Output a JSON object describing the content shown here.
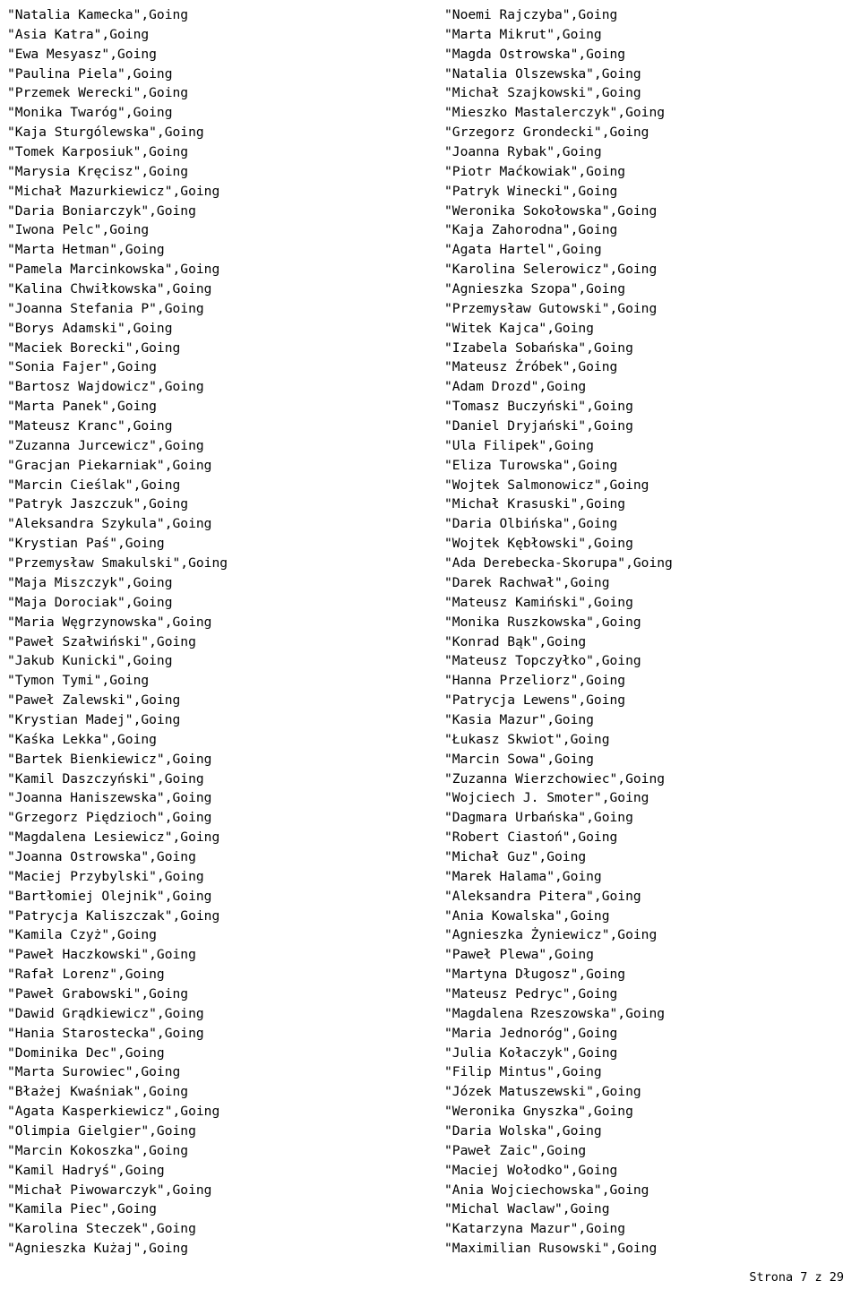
{
  "document": {
    "footer_text": "Strona 7 z 29",
    "status_label": "Going",
    "line_suffix": "\",Going",
    "line_prefix": "\""
  },
  "columns": {
    "left": [
      "\"Natalia Kamecka\",Going",
      "\"Asia Katra\",Going",
      "\"Ewa Mesyasz\",Going",
      "\"Paulina Piela\",Going",
      "\"Przemek Werecki\",Going",
      "\"Monika Twaróg\",Going",
      "\"Kaja Sturgólewska\",Going",
      "\"Tomek Karposiuk\",Going",
      "\"Marysia Kręcisz\",Going",
      "\"Michał Mazurkiewicz\",Going",
      "\"Daria Boniarczyk\",Going",
      "\"Iwona Pelc\",Going",
      "\"Marta Hetman\",Going",
      "\"Pamela Marcinkowska\",Going",
      "\"Kalina Chwiłkowska\",Going",
      "\"Joanna Stefania P\",Going",
      "\"Borys Adamski\",Going",
      "\"Maciek Borecki\",Going",
      "\"Sonia Fajer\",Going",
      "\"Bartosz Wajdowicz\",Going",
      "\"Marta Panek\",Going",
      "\"Mateusz Kranc\",Going",
      "\"Zuzanna Jurcewicz\",Going",
      "\"Gracjan Piekarniak\",Going",
      "\"Marcin Cieślak\",Going",
      "\"Patryk Jaszczuk\",Going",
      "\"Aleksandra Szykula\",Going",
      "\"Krystian Paś\",Going",
      "\"Przemysław Smakulski\",Going",
      "\"Maja Miszczyk\",Going",
      "\"Maja Dorociak\",Going",
      "\"Maria Węgrzynowska\",Going",
      "\"Paweł Szałwiński\",Going",
      "\"Jakub Kunicki\",Going",
      "\"Tymon Tymi\",Going",
      "\"Paweł Zalewski\",Going",
      "\"Krystian Madej\",Going",
      "\"Kaśka Lekka\",Going",
      "\"Bartek Bienkiewicz\",Going",
      "\"Kamil Daszczyński\",Going",
      "\"Joanna Haniszewska\",Going",
      "\"Grzegorz Piędzioch\",Going",
      "\"Magdalena Lesiewicz\",Going",
      "\"Joanna Ostrowska\",Going",
      "\"Maciej Przybylski\",Going",
      "\"Bartłomiej Olejnik\",Going",
      "\"Patrycja Kaliszczak\",Going",
      "\"Kamila Czyż\",Going",
      "\"Paweł Haczkowski\",Going",
      "\"Rafał Lorenz\",Going",
      "\"Paweł Grabowski\",Going",
      "\"Dawid Grądkiewicz\",Going",
      "\"Hania Starostecka\",Going",
      "\"Dominika Dec\",Going",
      "\"Marta Surowiec\",Going",
      "\"Błażej Kwaśniak\",Going",
      "\"Agata Kasperkiewicz\",Going",
      "\"Olimpia Gielgier\",Going",
      "\"Marcin Kokoszka\",Going",
      "\"Kamil Hadryś\",Going",
      "\"Michał Piwowarczyk\",Going",
      "\"Kamila Piec\",Going",
      "\"Karolina Steczek\",Going",
      "\"Agnieszka Kużaj\",Going"
    ],
    "right": [
      "\"Noemi Rajczyba\",Going",
      "\"Marta Mikrut\",Going",
      "\"Magda Ostrowska\",Going",
      "\"Natalia Olszewska\",Going",
      "\"Michał Szajkowski\",Going",
      "\"Mieszko Mastalerczyk\",Going",
      "\"Grzegorz Grondecki\",Going",
      "\"Joanna Rybak\",Going",
      "\"Piotr Maćkowiak\",Going",
      "\"Patryk Winecki\",Going",
      "\"Weronika Sokołowska\",Going",
      "\"Kaja Zahorodna\",Going",
      "\"Agata Hartel\",Going",
      "\"Karolina Selerowicz\",Going",
      "\"Agnieszka Szopa\",Going",
      "\"Przemysław Gutowski\",Going",
      "\"Witek Kajca\",Going",
      "\"Izabela Sobańska\",Going",
      "\"Mateusz Źróbek\",Going",
      "\"Adam Drozd\",Going",
      "\"Tomasz Buczyński\",Going",
      "\"Daniel Dryjański\",Going",
      "\"Ula Filipek\",Going",
      "\"Eliza Turowska\",Going",
      "\"Wojtek Salmonowicz\",Going",
      "\"Michał Krasuski\",Going",
      "\"Daria Olbińska\",Going",
      "\"Wojtek Kębłowski\",Going",
      "\"Ada Derebecka-Skorupa\",Going",
      "\"Darek Rachwał\",Going",
      "\"Mateusz Kamiński\",Going",
      "\"Monika Ruszkowska\",Going",
      "\"Konrad Bąk\",Going",
      "\"Mateusz Topczyłko\",Going",
      "\"Hanna Przeliorz\",Going",
      "\"Patrycja Lewens\",Going",
      "\"Kasia Mazur\",Going",
      "\"Łukasz Skwiot\",Going",
      "\"Marcin Sowa\",Going",
      "\"Zuzanna Wierzchowiec\",Going",
      "\"Wojciech J. Smoter\",Going",
      "\"Dagmara Urbańska\",Going",
      "\"Robert Ciastoń\",Going",
      "\"Michał Guz\",Going",
      "\"Marek Halama\",Going",
      "\"Aleksandra Pitera\",Going",
      "\"Ania Kowalska\",Going",
      "\"Agnieszka Żyniewicz\",Going",
      "\"Paweł Plewa\",Going",
      "\"Martyna Długosz\",Going",
      "\"Mateusz Pedryc\",Going",
      "\"Magdalena Rzeszowska\",Going",
      "\"Maria Jednoróg\",Going",
      "\"Julia Kołaczyk\",Going",
      "\"Filip Mintus\",Going",
      "\"Józek Matuszewski\",Going",
      "\"Weronika Gnyszka\",Going",
      "\"Daria Wolska\",Going",
      "\"Paweł Zaic\",Going",
      "\"Maciej Wołodko\",Going",
      "\"Ania Wojciechowska\",Going",
      "\"Michal Waclaw\",Going",
      "\"Katarzyna Mazur\",Going",
      "\"Maximilian Rusowski\",Going"
    ]
  }
}
